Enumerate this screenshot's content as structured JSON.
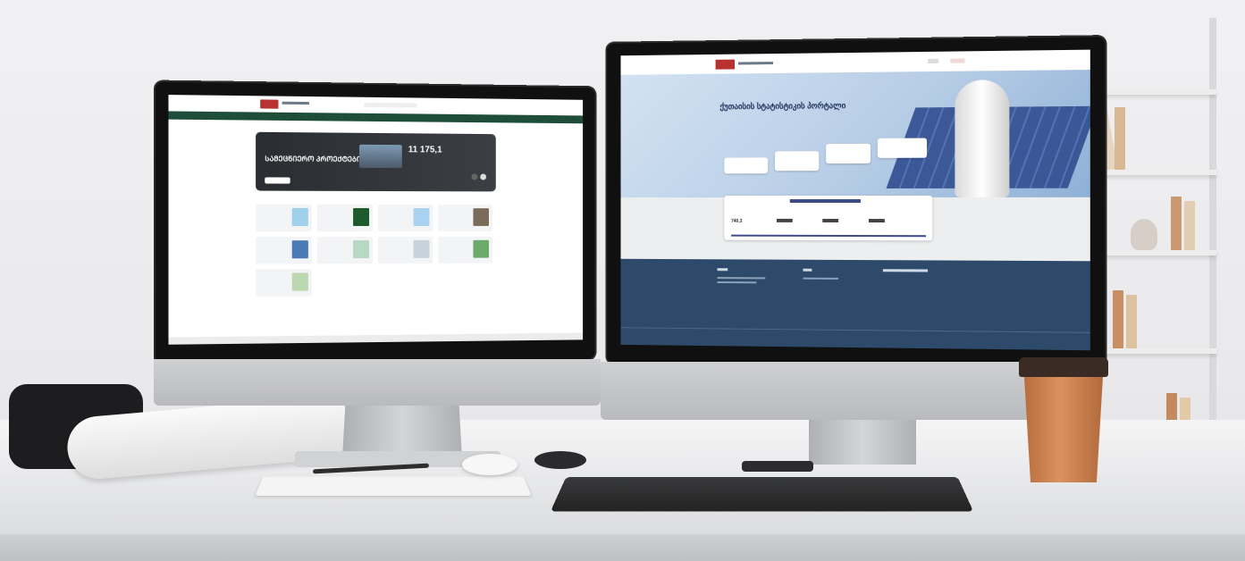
{
  "left_screen": {
    "banner_title": "ᲡᲐᲛᲔᲪᲜᲘᲔᲠᲝ ᲞᲠᲝᲔᲥᲢᲔᲑᲘ",
    "banner_number": "11 175,1",
    "banner_button": "",
    "card_labels": [
      "",
      "",
      "",
      "",
      "",
      "",
      "",
      "",
      ""
    ]
  },
  "right_screen": {
    "hero_title": "ქუთაისის სტატისტიკის პორტალი",
    "stats_title": "",
    "stat_values": [
      "740,3",
      "",
      "",
      ""
    ]
  },
  "colors": {
    "left_nav": "#1e4d3a",
    "right_footer": "#2e4a6b",
    "hero_sky": "#b7cde6",
    "cup": "#c97f4f"
  }
}
